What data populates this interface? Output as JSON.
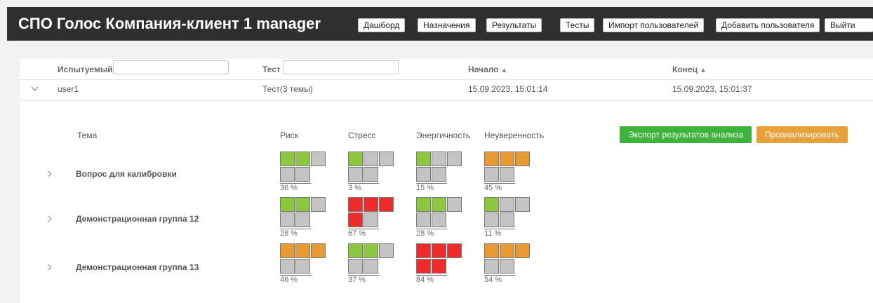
{
  "header": {
    "title": "СПО Голос Компания-клиент 1 manager",
    "nav": [
      "Дашборд",
      "Назначения",
      "Результаты",
      "Тесты",
      "Импорт пользователей",
      "Добавить пользователя",
      "Выйти"
    ]
  },
  "table": {
    "columns": {
      "subject": "Испытуемый",
      "test": "Тест",
      "start": "Начало",
      "end": "Конец"
    },
    "filters": {
      "subject_value": "",
      "test_value": ""
    },
    "row": {
      "user": "user1",
      "test": "Тест(3 темы)",
      "start": "15.09.2023, 15:01:14",
      "end": "15.09.2023, 15:01:37"
    }
  },
  "details": {
    "columns": {
      "topic": "Тема",
      "risk": "Риск",
      "stress": "Стресс",
      "energy": "Энергичность",
      "uncertainty": "Неуверенность"
    },
    "export_button": "Экспорт результатов анализа",
    "analyze_button": "Проанализировать",
    "topics": [
      {
        "name": "Вопрос для калибровки",
        "metrics": [
          {
            "label": "36 %",
            "filled": 2,
            "color": "#8dc63f"
          },
          {
            "label": "3 %",
            "filled": 1,
            "color": "#8dc63f"
          },
          {
            "label": "15 %",
            "filled": 1,
            "color": "#8dc63f"
          },
          {
            "label": "45 %",
            "filled": 3,
            "color": "#e99a33"
          }
        ]
      },
      {
        "name": "Демонстрационная группа 12",
        "metrics": [
          {
            "label": "28 %",
            "filled": 2,
            "color": "#8dc63f"
          },
          {
            "label": "67 %",
            "filled": 4,
            "color": "#ee2a2a"
          },
          {
            "label": "28 %",
            "filled": 2,
            "color": "#8dc63f"
          },
          {
            "label": "11 %",
            "filled": 1,
            "color": "#8dc63f"
          }
        ]
      },
      {
        "name": "Демонстрационная группа 13",
        "metrics": [
          {
            "label": "46 %",
            "filled": 3,
            "color": "#e99a33"
          },
          {
            "label": "37 %",
            "filled": 2,
            "color": "#8dc63f"
          },
          {
            "label": "84 %",
            "filled": 5,
            "color": "#ee2a2a"
          },
          {
            "label": "54 %",
            "filled": 3,
            "color": "#e99a33"
          }
        ]
      }
    ],
    "empty_color": "#c4c4c4"
  }
}
